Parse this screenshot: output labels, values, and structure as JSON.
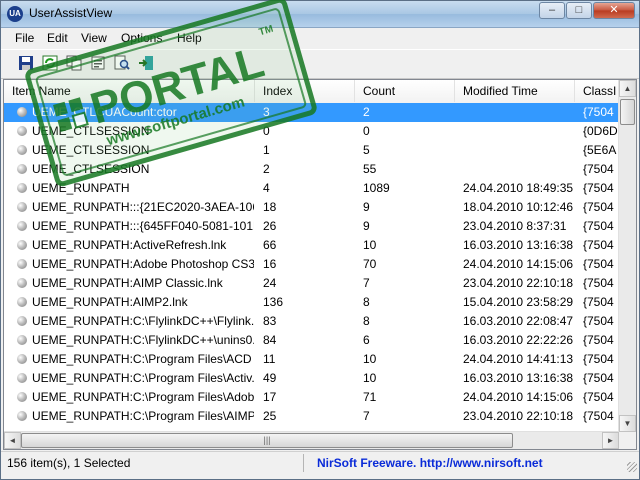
{
  "window": {
    "title": "UserAssistView",
    "controls": {
      "minimize": "–",
      "maximize": "□",
      "close": "✕"
    }
  },
  "menu": [
    "File",
    "Edit",
    "View",
    "Options",
    "Help"
  ],
  "toolbar_icons": [
    "save-icon",
    "refresh-icon",
    "copy-icon",
    "properties-icon",
    "find-icon",
    "exit-icon"
  ],
  "columns": [
    "Item Name",
    "Index",
    "Count",
    "Modified Time",
    "ClassI"
  ],
  "rows": [
    {
      "name": "UEME_CTLCUACount:ctor",
      "index": "3",
      "count": "2",
      "time": "",
      "classid": "{7504",
      "selected": true
    },
    {
      "name": "UEME_CTLSESSION",
      "index": "0",
      "count": "0",
      "time": "",
      "classid": "{0D6D"
    },
    {
      "name": "UEME_CTLSESSION",
      "index": "1",
      "count": "5",
      "time": "",
      "classid": "{5E6A"
    },
    {
      "name": "UEME_CTLSESSION",
      "index": "2",
      "count": "55",
      "time": "",
      "classid": "{7504"
    },
    {
      "name": "UEME_RUNPATH",
      "index": "4",
      "count": "1089",
      "time": "24.04.2010 18:49:35",
      "classid": "{7504"
    },
    {
      "name": "UEME_RUNPATH:::{21EC2020-3AEA-1069...",
      "index": "18",
      "count": "9",
      "time": "18.04.2010 10:12:46",
      "classid": "{7504"
    },
    {
      "name": "UEME_RUNPATH:::{645FF040-5081-101B-...",
      "index": "26",
      "count": "9",
      "time": "23.04.2010 8:37:31",
      "classid": "{7504"
    },
    {
      "name": "UEME_RUNPATH:ActiveRefresh.lnk",
      "index": "66",
      "count": "10",
      "time": "16.03.2010 13:16:38",
      "classid": "{7504"
    },
    {
      "name": "UEME_RUNPATH:Adobe Photoshop CS3...",
      "index": "16",
      "count": "70",
      "time": "24.04.2010 14:15:06",
      "classid": "{7504"
    },
    {
      "name": "UEME_RUNPATH:AIMP Classic.lnk",
      "index": "24",
      "count": "7",
      "time": "23.04.2010 22:10:18",
      "classid": "{7504"
    },
    {
      "name": "UEME_RUNPATH:AIMP2.lnk",
      "index": "136",
      "count": "8",
      "time": "15.04.2010 23:58:29",
      "classid": "{7504"
    },
    {
      "name": "UEME_RUNPATH:C:\\FlylinkDC++\\Flylink...",
      "index": "83",
      "count": "8",
      "time": "16.03.2010 22:08:47",
      "classid": "{7504"
    },
    {
      "name": "UEME_RUNPATH:C:\\FlylinkDC++\\unins0...",
      "index": "84",
      "count": "6",
      "time": "16.03.2010 22:22:26",
      "classid": "{7504"
    },
    {
      "name": "UEME_RUNPATH:C:\\Program Files\\ACD ...",
      "index": "11",
      "count": "10",
      "time": "24.04.2010 14:41:13",
      "classid": "{7504"
    },
    {
      "name": "UEME_RUNPATH:C:\\Program Files\\Activ...",
      "index": "49",
      "count": "10",
      "time": "16.03.2010 13:16:38",
      "classid": "{7504"
    },
    {
      "name": "UEME_RUNPATH:C:\\Program Files\\Adob...",
      "index": "17",
      "count": "71",
      "time": "24.04.2010 14:15:06",
      "classid": "{7504"
    },
    {
      "name": "UEME_RUNPATH:C:\\Program Files\\AIMP...",
      "index": "25",
      "count": "7",
      "time": "23.04.2010 22:10:18",
      "classid": "{7504"
    }
  ],
  "scroll": {
    "up": "▲",
    "down": "▼",
    "left": "◄",
    "right": "►",
    "grip": "|||"
  },
  "status": {
    "items": "156 item(s), 1 Selected",
    "link": "NirSoft Freeware.  http://www.nirsoft.net"
  },
  "watermark": {
    "main": "PORTAL",
    "sub": "www.softportal.com",
    "tm": "TM",
    "color": "#167822"
  }
}
